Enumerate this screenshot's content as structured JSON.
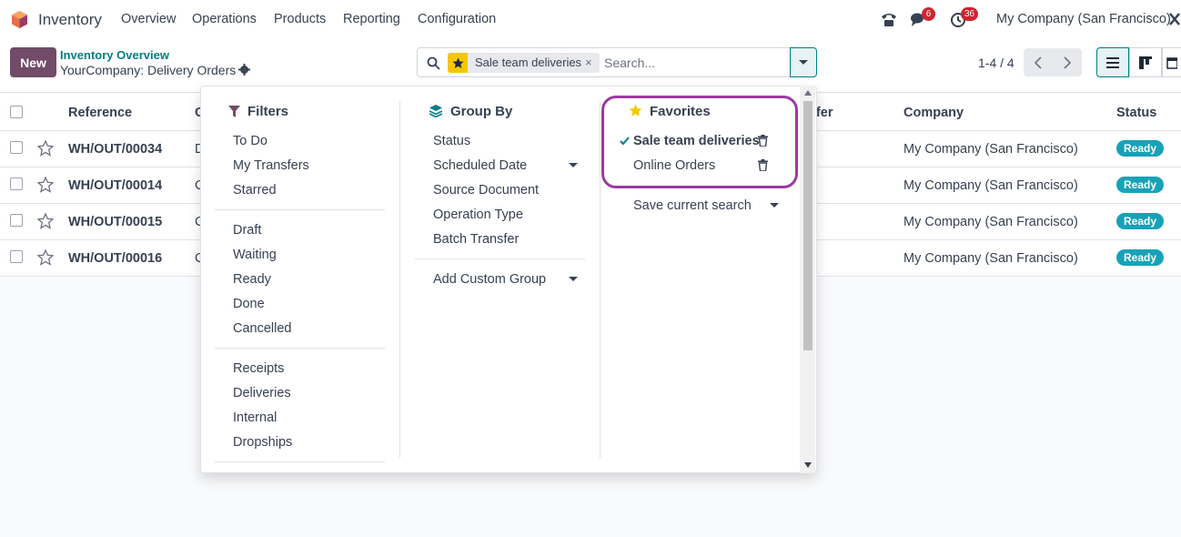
{
  "app": {
    "name": "Inventory"
  },
  "nav": [
    "Overview",
    "Operations",
    "Products",
    "Reporting",
    "Configuration"
  ],
  "systray": {
    "messages_count": "6",
    "activities_count": "36",
    "company": "My Company (San Francisco)"
  },
  "control": {
    "new_label": "New",
    "breadcrumb_parent": "Inventory Overview",
    "breadcrumb_current": "YourCompany: Delivery Orders",
    "search": {
      "facet": "Sale team deliveries",
      "facet_remove": "×",
      "placeholder": "Search..."
    },
    "pager": "1-4 / 4"
  },
  "table": {
    "headers": {
      "reference": "Reference",
      "contact_partial": "C",
      "transfer_partial": "nsfer",
      "company": "Company",
      "status": "Status"
    },
    "rows": [
      {
        "reference": "WH/OUT/00034",
        "contact_partial": "D",
        "company": "My Company (San Francisco)",
        "status": "Ready"
      },
      {
        "reference": "WH/OUT/00014",
        "contact_partial": "C",
        "company": "My Company (San Francisco)",
        "status": "Ready"
      },
      {
        "reference": "WH/OUT/00015",
        "contact_partial": "C",
        "company": "My Company (San Francisco)",
        "status": "Ready"
      },
      {
        "reference": "WH/OUT/00016",
        "contact_partial": "C",
        "company": "My Company (San Francisco)",
        "status": "Ready"
      }
    ]
  },
  "dropdown": {
    "filters": {
      "title": "Filters",
      "group1": [
        "To Do",
        "My Transfers",
        "Starred"
      ],
      "group2": [
        "Draft",
        "Waiting",
        "Ready",
        "Done",
        "Cancelled"
      ],
      "group3": [
        "Receipts",
        "Deliveries",
        "Internal",
        "Dropships"
      ]
    },
    "group_by": {
      "title": "Group By",
      "items": [
        "Status",
        "Scheduled Date",
        "Source Document",
        "Operation Type",
        "Batch Transfer"
      ],
      "custom": "Add Custom Group"
    },
    "favorites": {
      "title": "Favorites",
      "items": [
        "Sale team deliveries",
        "Online Orders"
      ],
      "save": "Save current search"
    }
  },
  "colors": {
    "brand": "#714b67",
    "accent": "#017e84",
    "ready": "#17a2b8",
    "badge": "#d0242f",
    "highlight": "#9b3aa0",
    "star": "#f3c800"
  }
}
